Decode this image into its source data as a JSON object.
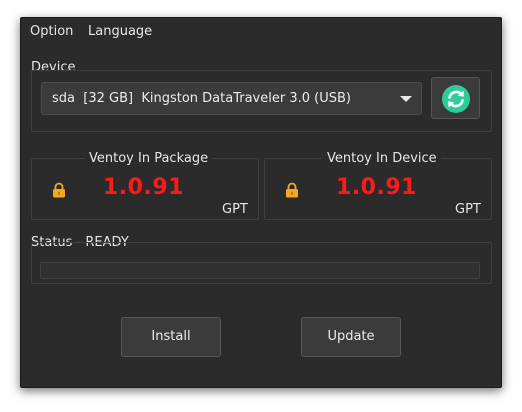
{
  "menu": {
    "option_label": "Option",
    "language_label": "Language"
  },
  "device": {
    "group_title": "Device",
    "selected": "sda  [32 GB]  Kingston DataTraveler 3.0 (USB)",
    "refresh_icon": "refresh-icon"
  },
  "package_panel": {
    "title": "Ventoy In Package",
    "version": "1.0.91",
    "partition_style": "GPT",
    "icon": "lock-icon"
  },
  "device_panel": {
    "title": "Ventoy In Device",
    "version": "1.0.91",
    "partition_style": "GPT",
    "icon": "lock-icon"
  },
  "status": {
    "label": "Status - READY",
    "progress": 0
  },
  "buttons": {
    "install_label": "Install",
    "update_label": "Update"
  },
  "colors": {
    "version_text": "#ff1a1a",
    "refresh_icon": "#2ecc9a",
    "lock_icon": "#f5a623",
    "window_bg": "#2b2b2b"
  }
}
